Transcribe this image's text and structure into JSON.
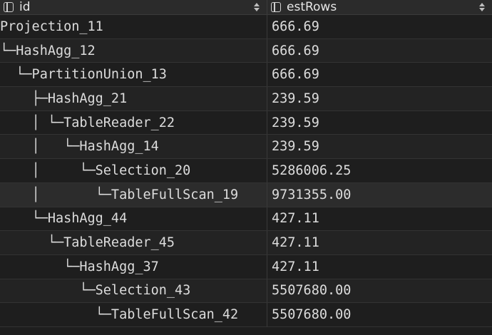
{
  "columns": [
    {
      "label": "id",
      "icon": "column-icon"
    },
    {
      "label": "estRows",
      "icon": "column-icon"
    }
  ],
  "rows": [
    {
      "id": "Projection_11",
      "estRows": "666.69"
    },
    {
      "id": "└─HashAgg_12",
      "estRows": "666.69"
    },
    {
      "id": "  └─PartitionUnion_13",
      "estRows": "666.69"
    },
    {
      "id": "    ├─HashAgg_21",
      "estRows": "239.59"
    },
    {
      "id": "    │ └─TableReader_22",
      "estRows": "239.59"
    },
    {
      "id": "    │   └─HashAgg_14",
      "estRows": "239.59"
    },
    {
      "id": "    │     └─Selection_20",
      "estRows": "5286006.25"
    },
    {
      "id": "    │       └─TableFullScan_19",
      "estRows": "9731355.00"
    },
    {
      "id": "    └─HashAgg_44",
      "estRows": "427.11"
    },
    {
      "id": "      └─TableReader_45",
      "estRows": "427.11"
    },
    {
      "id": "        └─HashAgg_37",
      "estRows": "427.11"
    },
    {
      "id": "          └─Selection_43",
      "estRows": "5507680.00"
    },
    {
      "id": "            └─TableFullScan_42",
      "estRows": "5507680.00"
    }
  ],
  "colors": {
    "background": "#1e1e1e",
    "header": "#2b2b2b",
    "text": "#dcdcdc",
    "highlight_row": "#2c2c2c"
  }
}
